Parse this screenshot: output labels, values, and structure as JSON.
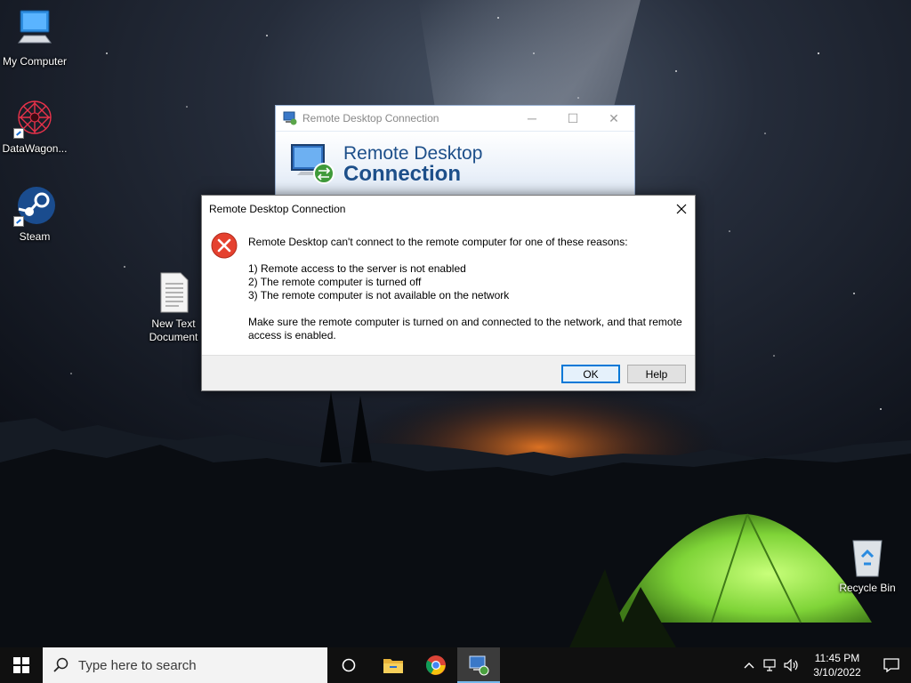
{
  "desktop": {
    "icons": [
      {
        "label": "My Computer",
        "icon": "computer-icon"
      },
      {
        "label": "DataWagon...",
        "icon": "datawagon-icon"
      },
      {
        "label": "Steam",
        "icon": "steam-icon"
      },
      {
        "label_line1": "New Text",
        "label_line2": "Document",
        "icon": "text-document-icon"
      },
      {
        "label": "Recycle Bin",
        "icon": "recycle-bin-icon"
      }
    ]
  },
  "rdc_window": {
    "title": "Remote Desktop Connection",
    "banner_line1": "Remote Desktop",
    "banner_line2": "Connection",
    "controls": {
      "minimize": "─",
      "maximize": "☐",
      "close": "✕"
    }
  },
  "error_dialog": {
    "title": "Remote Desktop Connection",
    "close": "✕",
    "icon": "error-icon",
    "intro": "Remote Desktop can't connect to the remote computer for one of these reasons:",
    "reasons": [
      "1) Remote access to the server is not enabled",
      "2) The remote computer is turned off",
      "3) The remote computer is not available on the network"
    ],
    "advice": "Make sure the remote computer is turned on and connected to the network, and that remote access is enabled.",
    "buttons": {
      "ok": "OK",
      "help": "Help"
    }
  },
  "taskbar": {
    "search_placeholder": "Type here to search",
    "apps": [
      "task-view-icon",
      "file-explorer-icon",
      "chrome-icon",
      "remote-desktop-icon"
    ],
    "clock": {
      "time": "11:45 PM",
      "date": "3/10/2022"
    },
    "tray": [
      "chevron-up-icon",
      "network-icon",
      "volume-icon",
      "notification-icon"
    ]
  },
  "colors": {
    "accent": "#0078d7",
    "taskbar": "#101010",
    "dialog_footer": "#f0f0f0",
    "rdc_title_blue": "#1d4f8a",
    "error_red": "#e5412f",
    "tent_green": "#8ee64a"
  }
}
